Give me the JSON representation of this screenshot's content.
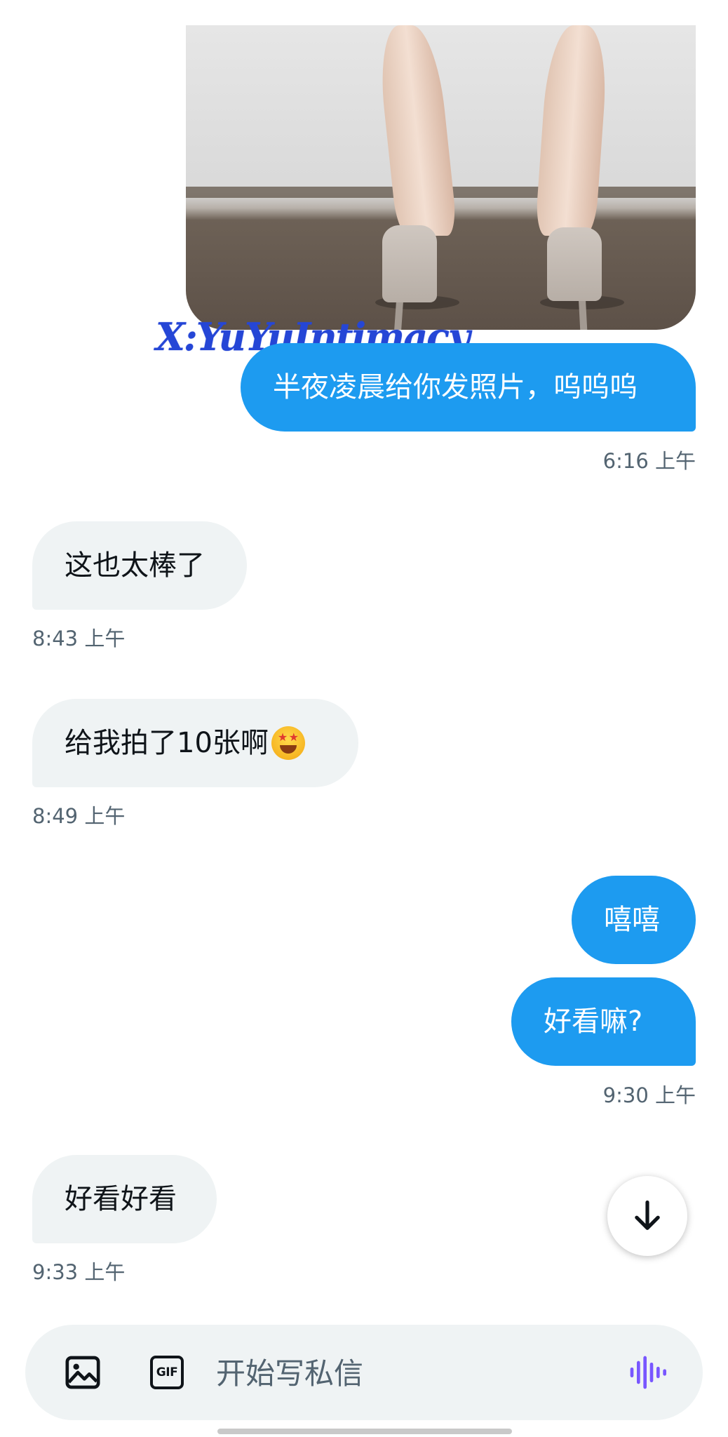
{
  "conversation": {
    "watermark": "X:YuYuIntimacy",
    "messages": [
      {
        "id": "m1",
        "direction": "sent",
        "text": "半夜凌晨给你发照片，呜呜呜",
        "time": "6:16 上午"
      },
      {
        "id": "m2",
        "direction": "received",
        "text": "这也太棒了",
        "time": "8:43 上午"
      },
      {
        "id": "m3",
        "direction": "received",
        "text": "给我拍了10张啊",
        "emoji": "star-struck",
        "time": "8:49 上午"
      },
      {
        "id": "m4",
        "direction": "sent",
        "text": "嘻嘻"
      },
      {
        "id": "m5",
        "direction": "sent",
        "text": "好看嘛?",
        "time": "9:30 上午"
      },
      {
        "id": "m6",
        "direction": "received",
        "text": "好看好看",
        "time": "9:33 上午"
      }
    ]
  },
  "scroll_button": {
    "icon": "arrow-down-icon"
  },
  "composer": {
    "placeholder": "开始写私信",
    "value": "",
    "image_icon": "image-icon",
    "gif_label": "GIF",
    "voice_icon": "voice-waveform-icon"
  },
  "colors": {
    "sent_bubble": "#1d9bf0",
    "received_bubble": "#eff3f4",
    "timestamp": "#536471",
    "voice_accent": "#7856ff",
    "watermark": "#2546d6"
  }
}
